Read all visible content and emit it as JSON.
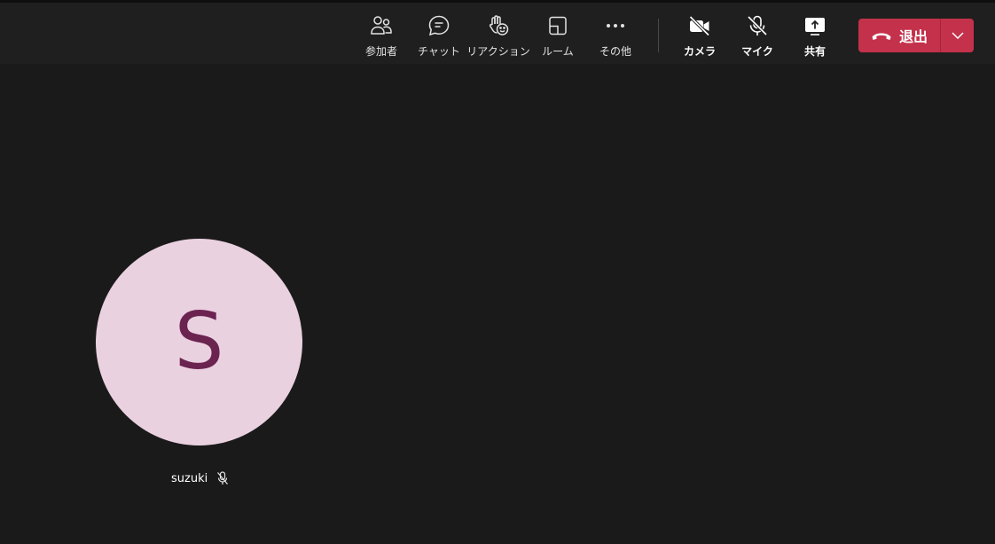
{
  "toolbar": {
    "participants_label": "参加者",
    "chat_label": "チャット",
    "reactions_label": "リアクション",
    "rooms_label": "ルーム",
    "more_label": "その他",
    "camera_label": "カメラ",
    "mic_label": "マイク",
    "share_label": "共有",
    "leave_label": "退出"
  },
  "participant": {
    "initial": "S",
    "name": "suzuki",
    "avatar_bg": "#ead1e0",
    "avatar_fg": "#6b2350",
    "muted": true
  },
  "colors": {
    "leave_button": "#c4314b",
    "background": "#1b1a1a",
    "toolbar_bg": "#201f1f"
  },
  "icons": {
    "participants": "people-icon",
    "chat": "chat-bubble-icon",
    "reactions": "raise-hand-icon",
    "rooms": "rooms-icon",
    "more": "more-dots-icon",
    "camera": "camera-off-icon",
    "mic": "mic-off-icon",
    "share": "share-screen-icon",
    "leave": "phone-hangup-icon",
    "leave_dropdown": "chevron-down-icon"
  }
}
